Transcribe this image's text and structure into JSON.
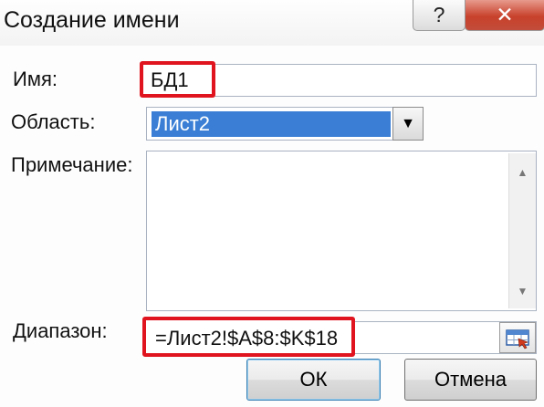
{
  "window": {
    "title": "Создание имени",
    "help_button": "?",
    "close_button": "✕"
  },
  "fields": {
    "name_label": "Имя:",
    "name_value": "БД1",
    "scope_label": "Область:",
    "scope_value": "Лист2",
    "comment_label": "Примечание:",
    "comment_value": "",
    "range_label": "Диапазон:",
    "range_value": "=Лист2!$A$8:$K$18"
  },
  "buttons": {
    "ok": "ОК",
    "cancel": "Отмена"
  },
  "icons": {
    "dropdown": "chevron-down-icon",
    "scroll_up": "scroll-up-icon",
    "scroll_down": "scroll-down-icon",
    "range_select": "range-select-icon"
  },
  "colors": {
    "highlight": "#e0141e",
    "selection": "#3a7fd5",
    "close": "#c8412b"
  }
}
